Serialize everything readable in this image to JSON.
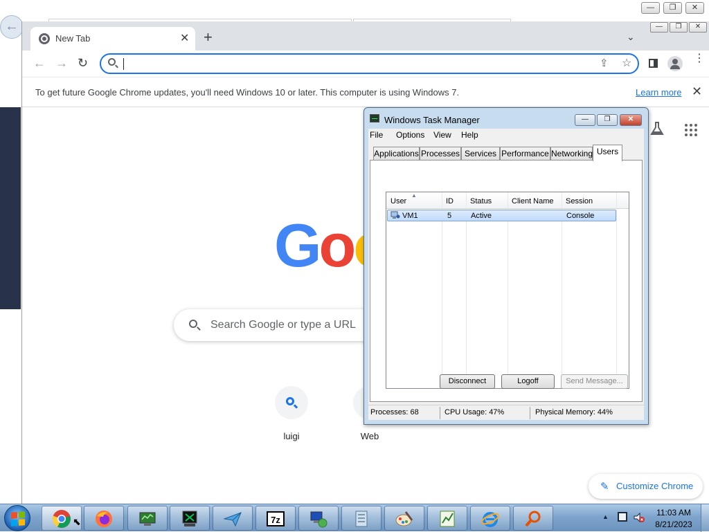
{
  "background_window": {
    "controls": [
      "—",
      "❐",
      "✕"
    ]
  },
  "chrome": {
    "tab": {
      "title": "New Tab",
      "close": "✕"
    },
    "new_tab": "+",
    "tab_menu": "⌄",
    "window_controls": [
      "—",
      "❐",
      "✕"
    ],
    "omnibox": {
      "value": "",
      "placeholder": ""
    },
    "infobar": {
      "message": "To get future Google Chrome updates, you'll need Windows 10 or later. This computer is using Windows 7.",
      "link": "Learn more",
      "close": "✕"
    },
    "ntp": {
      "logo_letters": [
        {
          "char": "G",
          "color": "#4285f4"
        },
        {
          "char": "o",
          "color": "#ea4335"
        },
        {
          "char": "o",
          "color": "#fbbc05"
        }
      ],
      "search_placeholder": "Search Google or type a URL",
      "shortcuts": [
        {
          "label": "luigi",
          "icon": "search-icon"
        },
        {
          "label": "Web",
          "icon": "web-icon"
        }
      ],
      "customize_label": "Customize Chrome"
    }
  },
  "task_manager": {
    "title": "Windows Task Manager",
    "controls": [
      "—",
      "❐",
      "✕"
    ],
    "menus": [
      "File",
      "Options",
      "View",
      "Help"
    ],
    "tabs": [
      "Applications",
      "Processes",
      "Services",
      "Performance",
      "Networking",
      "Users"
    ],
    "active_tab": "Users",
    "columns": [
      "User",
      "ID",
      "Status",
      "Client Name",
      "Session"
    ],
    "rows": [
      {
        "user": "VM1",
        "id": "5",
        "status": "Active",
        "client_name": "",
        "session": "Console"
      }
    ],
    "buttons": {
      "disconnect": "Disconnect",
      "logoff": "Logoff",
      "send_message": "Send Message..."
    },
    "status": {
      "processes": "Processes: 68",
      "cpu": "CPU Usage: 47%",
      "memory": "Physical Memory: 44%"
    }
  },
  "taskbar": {
    "apps": [
      "chrome-icon",
      "firefox-icon",
      "monitor-app-icon",
      "terminal-icon",
      "paper-plane-icon",
      "7zip-icon",
      "network-computer-icon",
      "document-icon",
      "paint-icon",
      "spreadsheet-icon",
      "internet-explorer-icon",
      "magnifier-icon"
    ],
    "clock": {
      "time": "11:03 AM",
      "date": "8/21/2023"
    },
    "tray_arrow": "▲"
  },
  "colors": {
    "chrome_blue": "#1a73e8",
    "taskbar": "#7fa5cd",
    "tm_frame": "#c8dcef",
    "selection": "#c1dbfc"
  }
}
